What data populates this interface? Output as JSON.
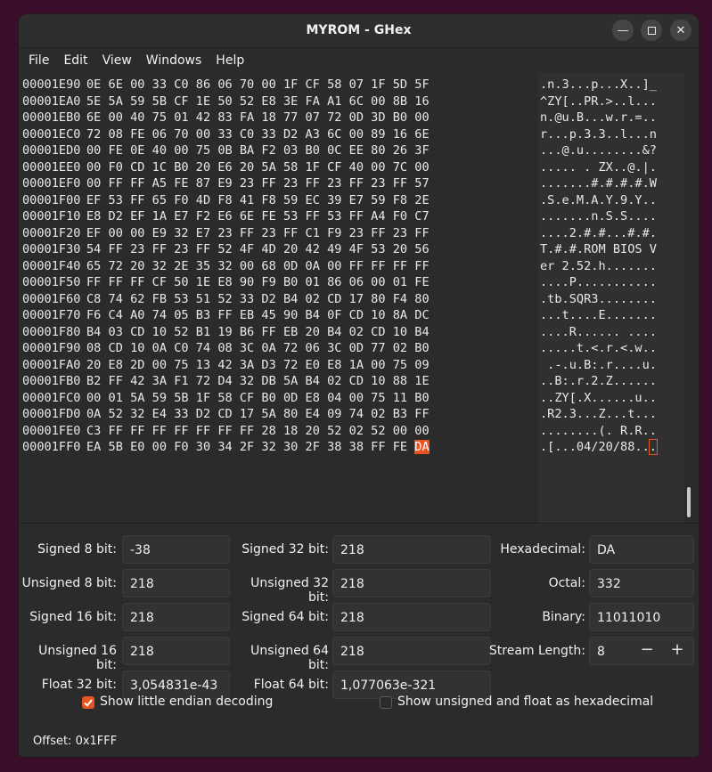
{
  "window": {
    "title": "MYROM - GHex"
  },
  "menu": [
    "File",
    "Edit",
    "View",
    "Windows",
    "Help"
  ],
  "hex_rows": [
    {
      "off": "00001E90",
      "hex": "0E 6E 00 33 C0 86 06 70 00 1F CF 58 07 1F 5D 5F",
      "ascii": ".n.3...p...X..]_"
    },
    {
      "off": "00001EA0",
      "hex": "5E 5A 59 5B CF 1E 50 52 E8 3E FA A1 6C 00 8B 16",
      "ascii": "^ZY[..PR.>..l..."
    },
    {
      "off": "00001EB0",
      "hex": "6E 00 40 75 01 42 83 FA 18 77 07 72 0D 3D B0 00",
      "ascii": "n.@u.B...w.r.=.."
    },
    {
      "off": "00001EC0",
      "hex": "72 08 FE 06 70 00 33 C0 33 D2 A3 6C 00 89 16 6E",
      "ascii": "r...p.3.3..l...n"
    },
    {
      "off": "00001ED0",
      "hex": "00 FE 0E 40 00 75 0B BA F2 03 B0 0C EE 80 26 3F",
      "ascii": "...@.u........&?"
    },
    {
      "off": "00001EE0",
      "hex": "00 F0 CD 1C B0 20 E6 20 5A 58 1F CF 40 00 7C 00",
      "ascii": "..... . ZX..@.|."
    },
    {
      "off": "00001EF0",
      "hex": "00 FF FF A5 FE 87 E9 23 FF 23 FF 23 FF 23 FF 57",
      "ascii": ".......#.#.#.#.W"
    },
    {
      "off": "00001F00",
      "hex": "EF 53 FF 65 F0 4D F8 41 F8 59 EC 39 E7 59 F8 2E",
      "ascii": ".S.e.M.A.Y.9.Y.."
    },
    {
      "off": "00001F10",
      "hex": "E8 D2 EF 1A E7 F2 E6 6E FE 53 FF 53 FF A4 F0 C7",
      "ascii": ".......n.S.S...."
    },
    {
      "off": "00001F20",
      "hex": "EF 00 00 E9 32 E7 23 FF 23 FF C1 F9 23 FF 23 FF",
      "ascii": "....2.#.#...#.#."
    },
    {
      "off": "00001F30",
      "hex": "54 FF 23 FF 23 FF 52 4F 4D 20 42 49 4F 53 20 56",
      "ascii": "T.#.#.ROM BIOS V"
    },
    {
      "off": "00001F40",
      "hex": "65 72 20 32 2E 35 32 00 68 0D 0A 00 FF FF FF FF",
      "ascii": "er 2.52.h......."
    },
    {
      "off": "00001F50",
      "hex": "FF FF FF CF 50 1E E8 90 F9 B0 01 86 06 00 01 FE",
      "ascii": "....P..........."
    },
    {
      "off": "00001F60",
      "hex": "C8 74 62 FB 53 51 52 33 D2 B4 02 CD 17 80 F4 80",
      "ascii": ".tb.SQR3........"
    },
    {
      "off": "00001F70",
      "hex": "F6 C4 A0 74 05 B3 FF EB 45 90 B4 0F CD 10 8A DC",
      "ascii": "...t....E......."
    },
    {
      "off": "00001F80",
      "hex": "B4 03 CD 10 52 B1 19 B6 FF EB 20 B4 02 CD 10 B4",
      "ascii": "....R...... ...."
    },
    {
      "off": "00001F90",
      "hex": "08 CD 10 0A C0 74 08 3C 0A 72 06 3C 0D 77 02 B0",
      "ascii": ".....t.<.r.<.w.."
    },
    {
      "off": "00001FA0",
      "hex": "20 E8 2D 00 75 13 42 3A D3 72 E0 E8 1A 00 75 09",
      "ascii": " .-.u.B:.r....u."
    },
    {
      "off": "00001FB0",
      "hex": "B2 FF 42 3A F1 72 D4 32 DB 5A B4 02 CD 10 88 1E",
      "ascii": "..B:.r.2.Z......"
    },
    {
      "off": "00001FC0",
      "hex": "00 01 5A 59 5B 1F 58 CF B0 0D E8 04 00 75 11 B0",
      "ascii": "..ZY[.X......u.."
    },
    {
      "off": "00001FD0",
      "hex": "0A 52 32 E4 33 D2 CD 17 5A 80 E4 09 74 02 B3 FF",
      "ascii": ".R2.3...Z...t..."
    },
    {
      "off": "00001FE0",
      "hex": "C3 FF FF FF FF FF FF FF 28 18 20 52 02 52 00 00",
      "ascii": "........(. R.R.."
    },
    {
      "off": "00001FF0",
      "hex": "EA 5B E0 00 F0 30 34 2F 32 30 2F 38 38 FF FE ",
      "hex_cursor": "DA",
      "ascii": ".[...04/20/88..",
      "ascii_cursor": "."
    }
  ],
  "inspector": {
    "signed8_label": "Signed 8 bit:",
    "signed8": "-38",
    "unsigned8_label": "Unsigned 8 bit:",
    "unsigned8": "218",
    "signed16_label": "Signed 16 bit:",
    "signed16": "218",
    "unsigned16_label": "Unsigned 16 bit:",
    "unsigned16": "218",
    "float32_label": "Float 32 bit:",
    "float32": "3,054831e-43",
    "signed32_label": "Signed 32 bit:",
    "signed32": "218",
    "unsigned32_label": "Unsigned 32 bit:",
    "unsigned32": "218",
    "signed64_label": "Signed 64 bit:",
    "signed64": "218",
    "unsigned64_label": "Unsigned 64 bit:",
    "unsigned64": "218",
    "float64_label": "Float 64 bit:",
    "float64": "1,077063e-321",
    "hex_label": "Hexadecimal:",
    "hex": "DA",
    "octal_label": "Octal:",
    "octal": "332",
    "binary_label": "Binary:",
    "binary": "11011010",
    "stream_label": "Stream Length:",
    "stream": "8",
    "stream_minus": "−",
    "stream_plus": "+"
  },
  "options": {
    "little_endian_label": "Show little endian decoding",
    "unsigned_hex_label": "Show unsigned and float as hexadecimal"
  },
  "status": {
    "offset": "Offset: 0x1FFF"
  },
  "colors": {
    "accent": "#e95420"
  }
}
